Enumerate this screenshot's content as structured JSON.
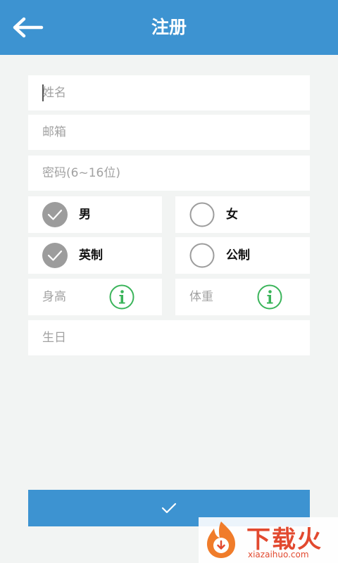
{
  "header": {
    "title": "注册",
    "back_icon": "arrow-left-icon"
  },
  "form": {
    "name_placeholder": "姓名",
    "email_placeholder": "邮箱",
    "password_placeholder": "密码(6~16位)",
    "gender_options": [
      {
        "label": "男",
        "selected": true
      },
      {
        "label": "女",
        "selected": false
      }
    ],
    "unit_options": [
      {
        "label": "英制",
        "selected": true
      },
      {
        "label": "公制",
        "selected": false
      }
    ],
    "height_label": "身高",
    "weight_label": "体重",
    "birthday_placeholder": "生日"
  },
  "submit": {
    "icon": "check-icon"
  },
  "watermark": {
    "text": "下载火",
    "url": "xiazaihuo.com"
  },
  "colors": {
    "primary": "#3d93d1",
    "background": "#f2f4f3",
    "selected_radio": "#9c9c9c",
    "info_green": "#3ab45a",
    "placeholder": "#a2a2a2"
  }
}
